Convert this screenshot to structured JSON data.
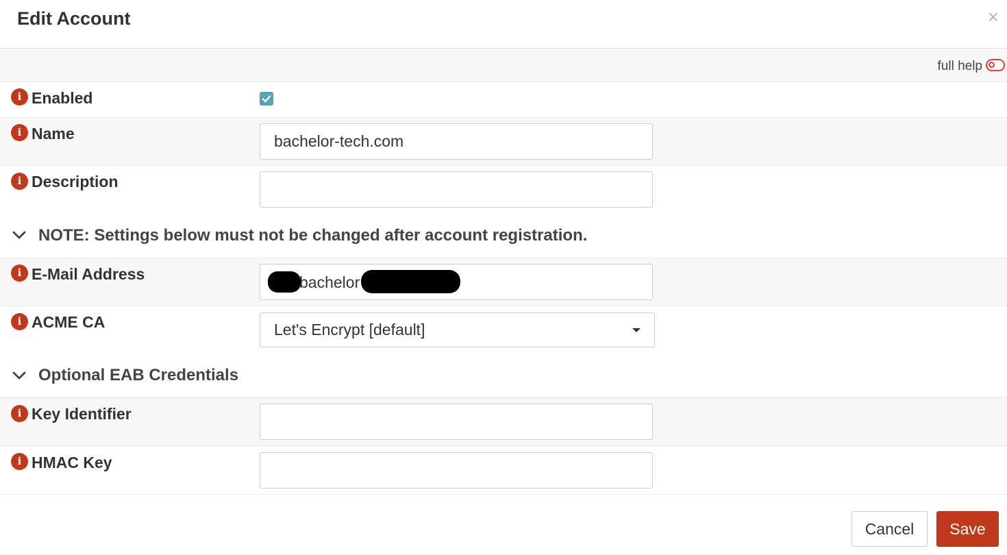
{
  "dialog": {
    "title": "Edit Account",
    "close_symbol": "×"
  },
  "help": {
    "label": "full help",
    "enabled": false
  },
  "fields": {
    "enabled": {
      "label": "Enabled",
      "checked": true
    },
    "name": {
      "label": "Name",
      "value": "bachelor-tech.com"
    },
    "description": {
      "label": "Description",
      "value": ""
    },
    "email": {
      "label": "E-Mail Address",
      "visible_value": "bachelor"
    },
    "acme_ca": {
      "label": "ACME CA",
      "selected": "Let's Encrypt [default]"
    },
    "key_identifier": {
      "label": "Key Identifier",
      "value": ""
    },
    "hmac_key": {
      "label": "HMAC Key",
      "value": ""
    }
  },
  "sections": {
    "note": "NOTE: Settings below must not be changed after account registration.",
    "eab": "Optional EAB Credentials"
  },
  "buttons": {
    "cancel": "Cancel",
    "save": "Save"
  },
  "info_icon_glyph": "i",
  "colors": {
    "accent": "#c0391b",
    "checkbox": "#55a4b2",
    "toggle": "#e03c3c"
  }
}
